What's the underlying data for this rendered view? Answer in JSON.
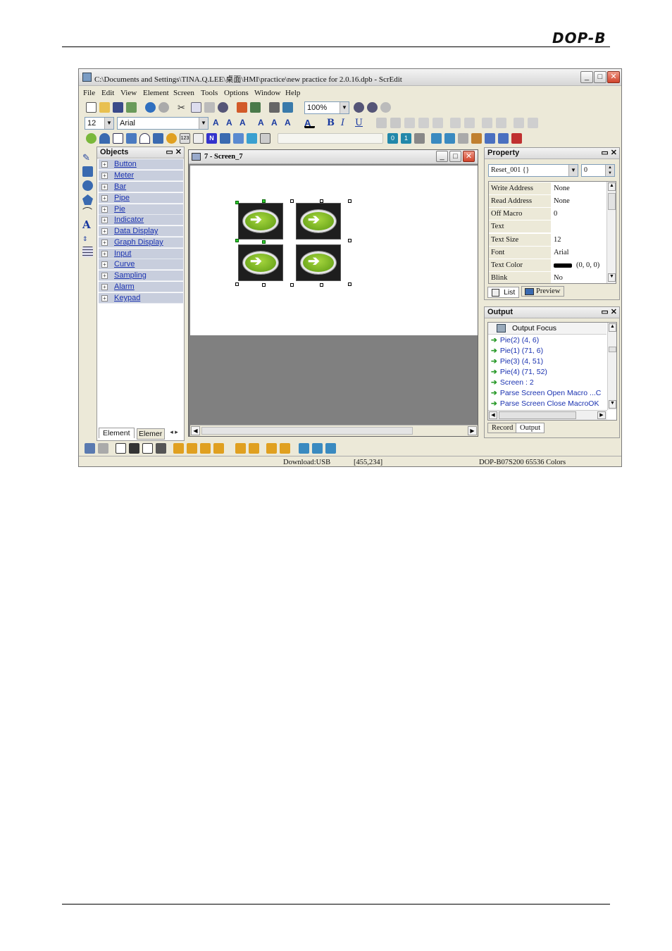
{
  "page": {
    "logo": "DOP-B"
  },
  "window": {
    "title": "C:\\Documents and Settings\\TINA.Q.LEE\\桌面\\HMI\\practice\\new practice for 2.0.16.dpb - ScrEdit",
    "menu": [
      "File",
      "Edit",
      "View",
      "Element",
      "Screen",
      "Tools",
      "Options",
      "Window",
      "Help"
    ],
    "zoom": "100%",
    "font_size": "12",
    "font_name": "Arial"
  },
  "objects_panel": {
    "title": "Objects",
    "items": [
      "Button",
      "Meter",
      "Bar",
      "Pipe",
      "Pie",
      "Indicator",
      "Data Display",
      "Graph Display",
      "Input",
      "Curve",
      "Sampling",
      "Alarm",
      "Keypad"
    ],
    "tabs": [
      "Element",
      "Elemer"
    ]
  },
  "screen_window": {
    "title": "7 - Screen_7"
  },
  "property_panel": {
    "title": "Property",
    "selector": "Reset_001 {}",
    "selector_num": "0",
    "rows": [
      {
        "key": "Write Address",
        "value": "None"
      },
      {
        "key": "Read Address",
        "value": "None"
      },
      {
        "key": "Off Macro",
        "value": "0"
      },
      {
        "key": "Text",
        "value": ""
      },
      {
        "key": "Text Size",
        "value": "12"
      },
      {
        "key": "Font",
        "value": "Arial"
      },
      {
        "key": "Text Color",
        "value": "(0, 0, 0)"
      },
      {
        "key": "Blink",
        "value": "No"
      }
    ],
    "tabs": [
      "List",
      "Preview"
    ]
  },
  "output_panel": {
    "title": "Output",
    "focus": "Output Focus",
    "lines": [
      "Pie(2) (4, 6)",
      "Pie(1) (71, 6)",
      "Pie(3) (4, 51)",
      "Pie(4) (71, 52)",
      "Screen : 2",
      "Parse Screen Open Macro ...C",
      "Parse Screen Close MacroOK"
    ],
    "tabs": [
      "Record",
      "Output"
    ]
  },
  "statusbar": {
    "download": "Download:USB",
    "coords": "[455,234]",
    "model": "DOP-B07S200 65536 Colors"
  }
}
